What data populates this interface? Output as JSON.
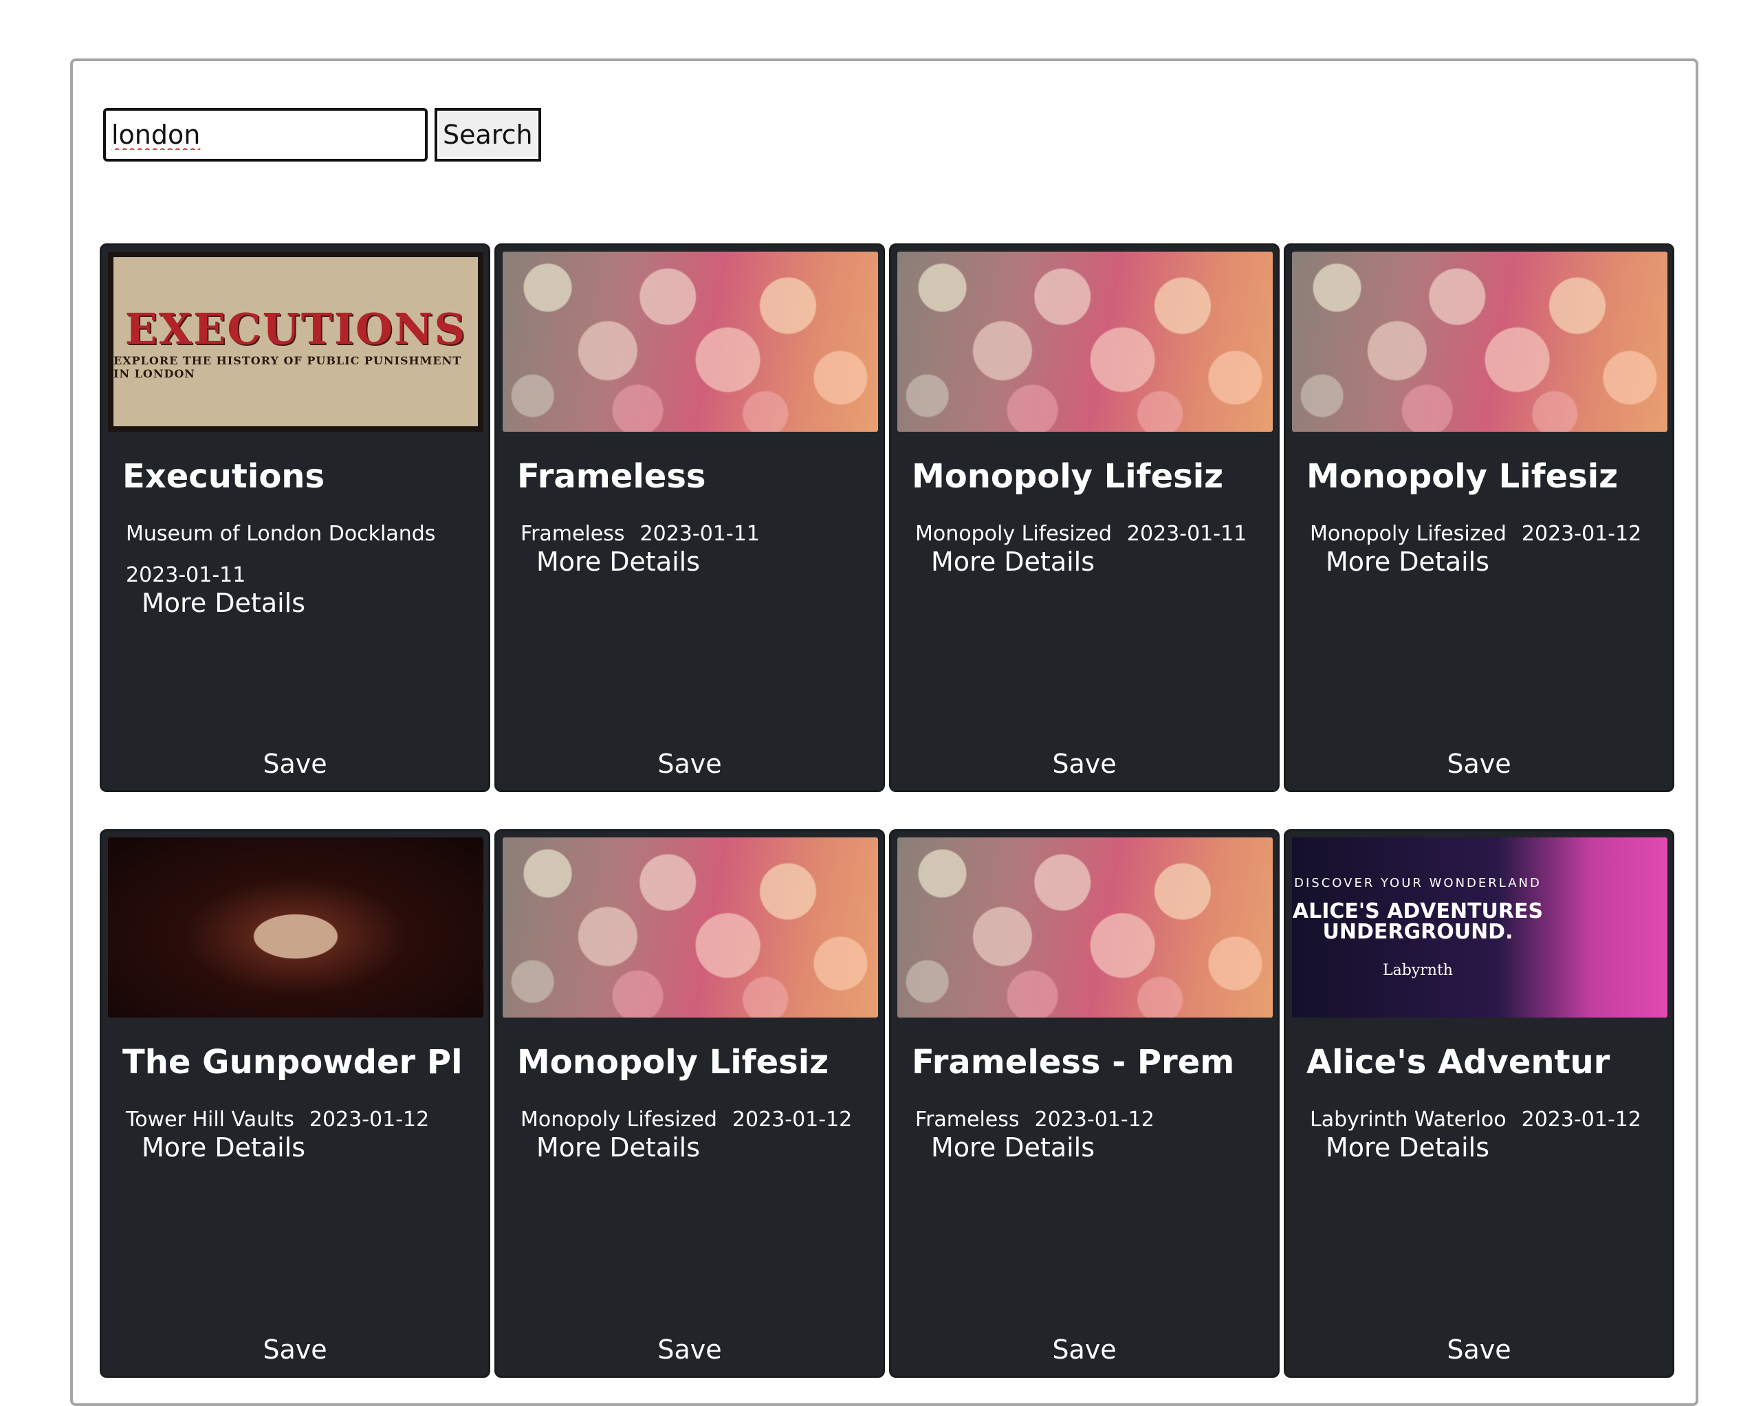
{
  "search": {
    "value": "london",
    "button_label": "Search"
  },
  "colors": {
    "card_bg": "#212529",
    "text": "#ffffff"
  },
  "cards": [
    {
      "title": "Executions",
      "venue": "Museum of London Docklands",
      "date": "2023-01-11",
      "details_label": "More Details",
      "save_label": "Save",
      "image": "executions-poster",
      "poster_text": {
        "headline": "EXECUTIONS",
        "tagline": "EXPLORE THE HISTORY OF PUBLIC PUNISHMENT IN LONDON"
      }
    },
    {
      "title": "Frameless",
      "venue": "Frameless",
      "date": "2023-01-11",
      "details_label": "More Details",
      "save_label": "Save",
      "image": "bokeh-placeholder"
    },
    {
      "title": "Monopoly Lifesiz",
      "venue": "Monopoly Lifesized",
      "date": "2023-01-11",
      "details_label": "More Details",
      "save_label": "Save",
      "image": "bokeh-placeholder"
    },
    {
      "title": "Monopoly Lifesiz",
      "venue": "Monopoly Lifesized",
      "date": "2023-01-12",
      "details_label": "More Details",
      "save_label": "Save",
      "image": "bokeh-placeholder"
    },
    {
      "title": "The Gunpowder Pl",
      "venue": "Tower Hill Vaults",
      "date": "2023-01-12",
      "details_label": "More Details",
      "save_label": "Save",
      "image": "gunpowder-portrait"
    },
    {
      "title": "Monopoly Lifesiz",
      "venue": "Monopoly Lifesized",
      "date": "2023-01-12",
      "details_label": "More Details",
      "save_label": "Save",
      "image": "bokeh-placeholder"
    },
    {
      "title": "Frameless - Prem",
      "venue": "Frameless",
      "date": "2023-01-12",
      "details_label": "More Details",
      "save_label": "Save",
      "image": "bokeh-placeholder"
    },
    {
      "title": "Alice's Adventur",
      "venue": "Labyrinth Waterloo",
      "date": "2023-01-12",
      "details_label": "More Details",
      "save_label": "Save",
      "image": "alice-poster",
      "poster_text": {
        "tagline": "DISCOVER YOUR WONDERLAND",
        "headline": "ALICE'S ADVENTURES UNDERGROUND.",
        "logo": "Labyrnth"
      }
    }
  ]
}
